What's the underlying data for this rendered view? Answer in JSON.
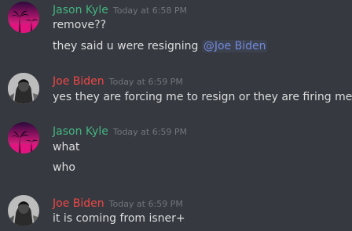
{
  "colors": {
    "background": "#36393f",
    "text": "#dcddde",
    "timestamp": "#72767d",
    "mention_text": "#7289da",
    "mention_bg": "rgba(114,137,218,0.1)"
  },
  "messages": [
    {
      "author": "Jason Kyle",
      "author_color": "#43b581",
      "avatar_icon": "palm-tree-sunset-avatar-icon",
      "timestamp": "Today at 6:58 PM",
      "lines": [
        {
          "text": "remove??"
        },
        {
          "text": "they said u were resigning ",
          "mention": "@Joe Biden"
        }
      ]
    },
    {
      "author": "Joe Biden",
      "author_color": "#f04747",
      "avatar_icon": "grayscale-portrait-avatar-icon",
      "timestamp": "Today at 6:59 PM",
      "lines": [
        {
          "text": "yes they are forcing me to resign or they are firing me"
        }
      ]
    },
    {
      "author": "Jason Kyle",
      "author_color": "#43b581",
      "avatar_icon": "palm-tree-sunset-avatar-icon",
      "timestamp": "Today at 6:59 PM",
      "lines": [
        {
          "text": "what"
        },
        {
          "text": "who"
        }
      ]
    },
    {
      "author": "Joe Biden",
      "author_color": "#f04747",
      "avatar_icon": "grayscale-portrait-avatar-icon",
      "timestamp": "Today at 6:59 PM",
      "lines": [
        {
          "text": "it is coming from isner+"
        }
      ]
    }
  ]
}
